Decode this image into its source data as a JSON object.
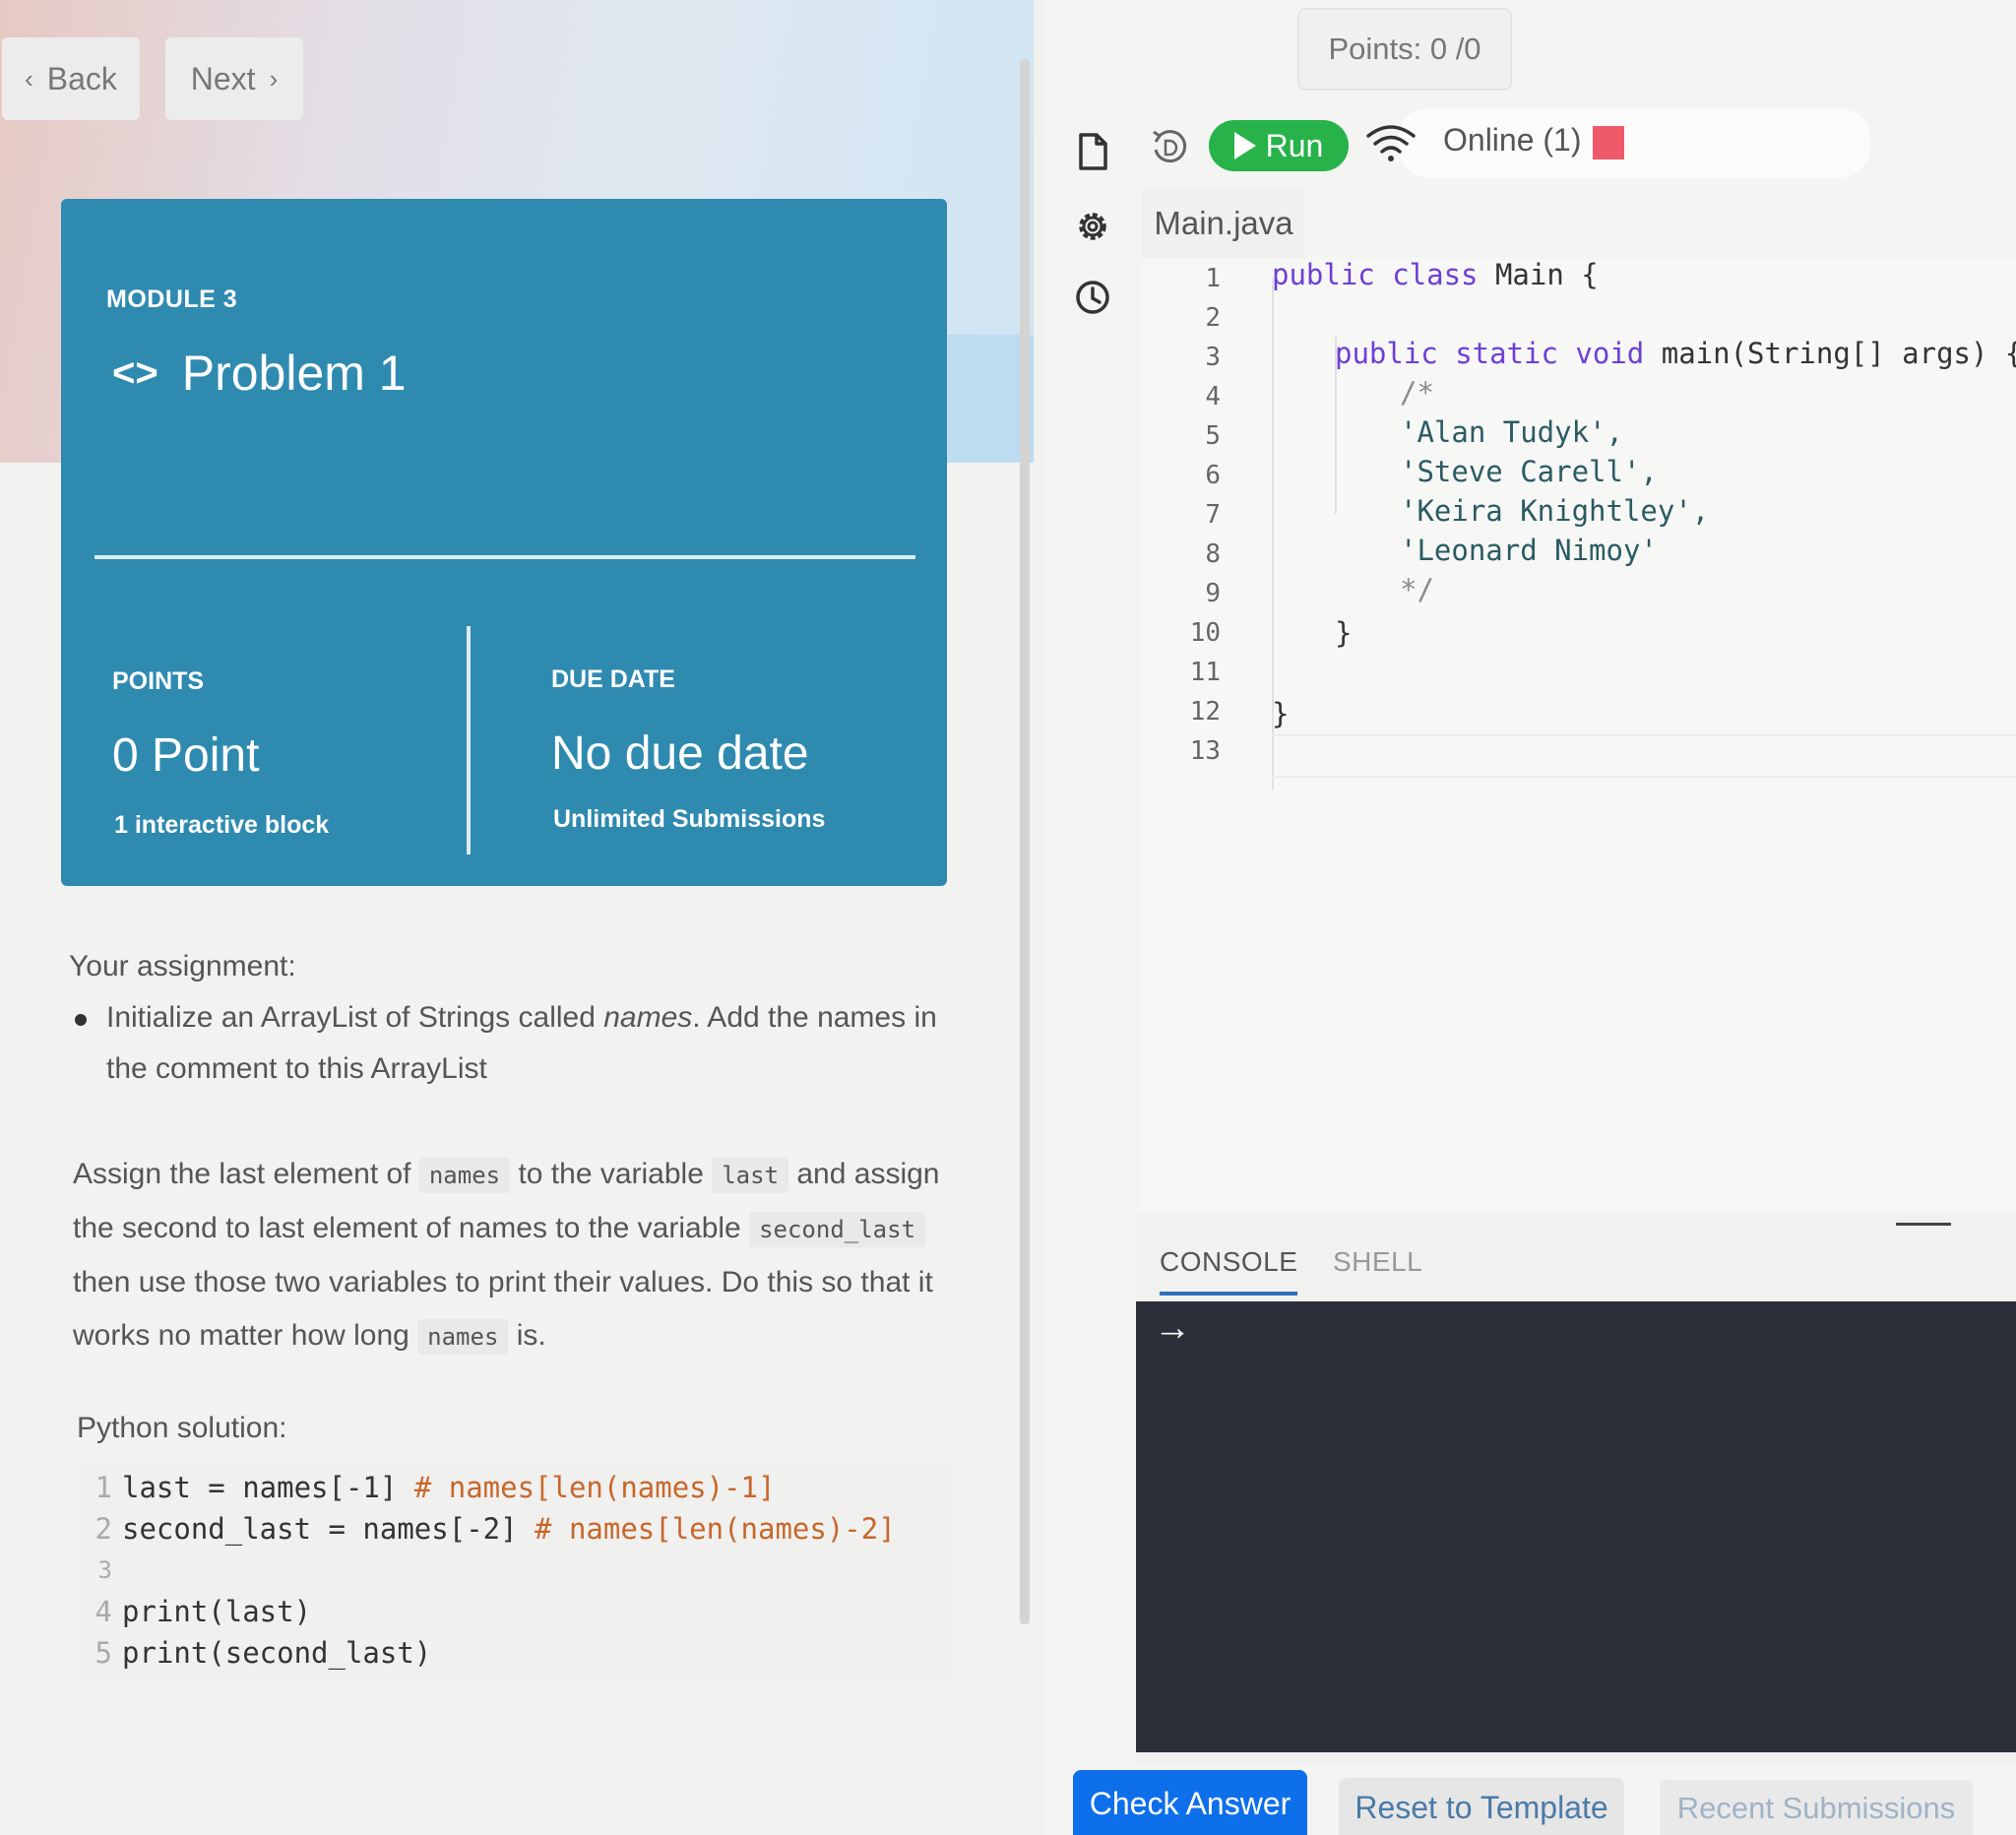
{
  "nav": {
    "back_label": "Back",
    "next_label": "Next"
  },
  "card": {
    "module": "MODULE 3",
    "title": "Problem 1",
    "points_label": "POINTS",
    "points_value": "0 Point",
    "points_sub": "1 interactive block",
    "due_label": "DUE DATE",
    "due_value": "No due date",
    "due_sub": "Unlimited Submissions"
  },
  "assignment": {
    "heading": "Your assignment:",
    "bullet_pre": "Initialize an ArrayList of Strings called ",
    "bullet_em": "names",
    "bullet_post": ". Add the names in the comment to this ArrayList",
    "para_1": "Assign the last element of ",
    "code_names": "names",
    "para_2": " to the variable ",
    "code_last": "last",
    "para_3": " and assign the second to last element of names to the variable ",
    "code_second_last": "second_last",
    "para_4": " then use those two variables to print their values. Do this so that it works no matter how long ",
    "code_names_2": "names",
    "para_5": " is."
  },
  "python": {
    "label": "Python solution:",
    "lines": [
      {
        "num": "1",
        "code": "last = names[-1] ",
        "comment": "# names[len(names)-1]"
      },
      {
        "num": "2",
        "code": "second_last = names[-2] ",
        "comment": "# names[len(names)-2]"
      },
      {
        "num": "3",
        "code": "",
        "comment": ""
      },
      {
        "num": "4",
        "code": "print(last)",
        "comment": ""
      },
      {
        "num": "5",
        "code": "print(second_last)",
        "comment": ""
      }
    ]
  },
  "header": {
    "points_badge": "Points: 0 /0"
  },
  "toolbar": {
    "run_label": "Run",
    "online_label": "Online (1)"
  },
  "editor": {
    "filename": "Main.java",
    "line_numbers": [
      "1",
      "2",
      "3",
      "4",
      "5",
      "6",
      "7",
      "8",
      "9",
      "10",
      "11",
      "12",
      "13"
    ],
    "lines": {
      "l1_kw": "public class",
      "l1_rest": " Main {",
      "l3_kw": "public static void",
      "l3_rest": " main(String[] args) {",
      "l4": "/*",
      "l5": "'Alan Tudyk',",
      "l6": "'Steve Carell',",
      "l7": "'Keira Knightley',",
      "l8": "'Leonard Nimoy'",
      "l9": "*/",
      "l10": "}",
      "l12": "}"
    }
  },
  "console": {
    "tab_console": "CONSOLE",
    "tab_shell": "SHELL",
    "prompt": "→"
  },
  "actions": {
    "check_answer": "Check Answer",
    "reset_template": "Reset to Template",
    "recent_submissions": "Recent Submissions"
  },
  "colors": {
    "card_bg": "#2f8ab0",
    "run_green": "#27b24a",
    "check_blue": "#0d6fea",
    "online_status": "#ef5a6a",
    "keyword": "#6d3fd6"
  }
}
